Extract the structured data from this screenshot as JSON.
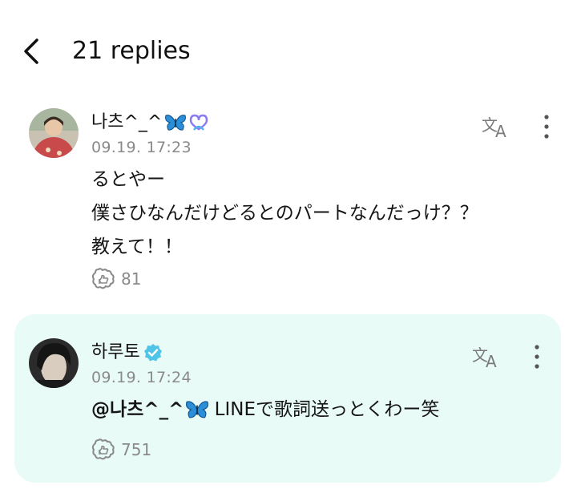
{
  "header": {
    "title": "21 replies"
  },
  "original": {
    "username": "나츠^_^",
    "timestamp": "09.19. 17:23",
    "lines": [
      "るとやー",
      "僕さひなんだけどるとのパートなんだっけ？？",
      "教えて！！"
    ],
    "like_count": "81"
  },
  "reply": {
    "username": "하루토",
    "timestamp": "09.19. 17:24",
    "mention": "@나츠^_^",
    "text": " LINEで歌詞送っとくわー笑",
    "like_count": "751"
  },
  "colors": {
    "reply_bg": "#e8fbf6",
    "butterfly": "#2a8fd8",
    "verified": "#4fc3e8",
    "ribbon": "#7b7bf0"
  },
  "icons": [
    "back-arrow-icon",
    "butterfly-icon",
    "ribbon-badge-icon",
    "verified-badge-icon",
    "translate-icon",
    "more-options-icon",
    "like-icon"
  ]
}
